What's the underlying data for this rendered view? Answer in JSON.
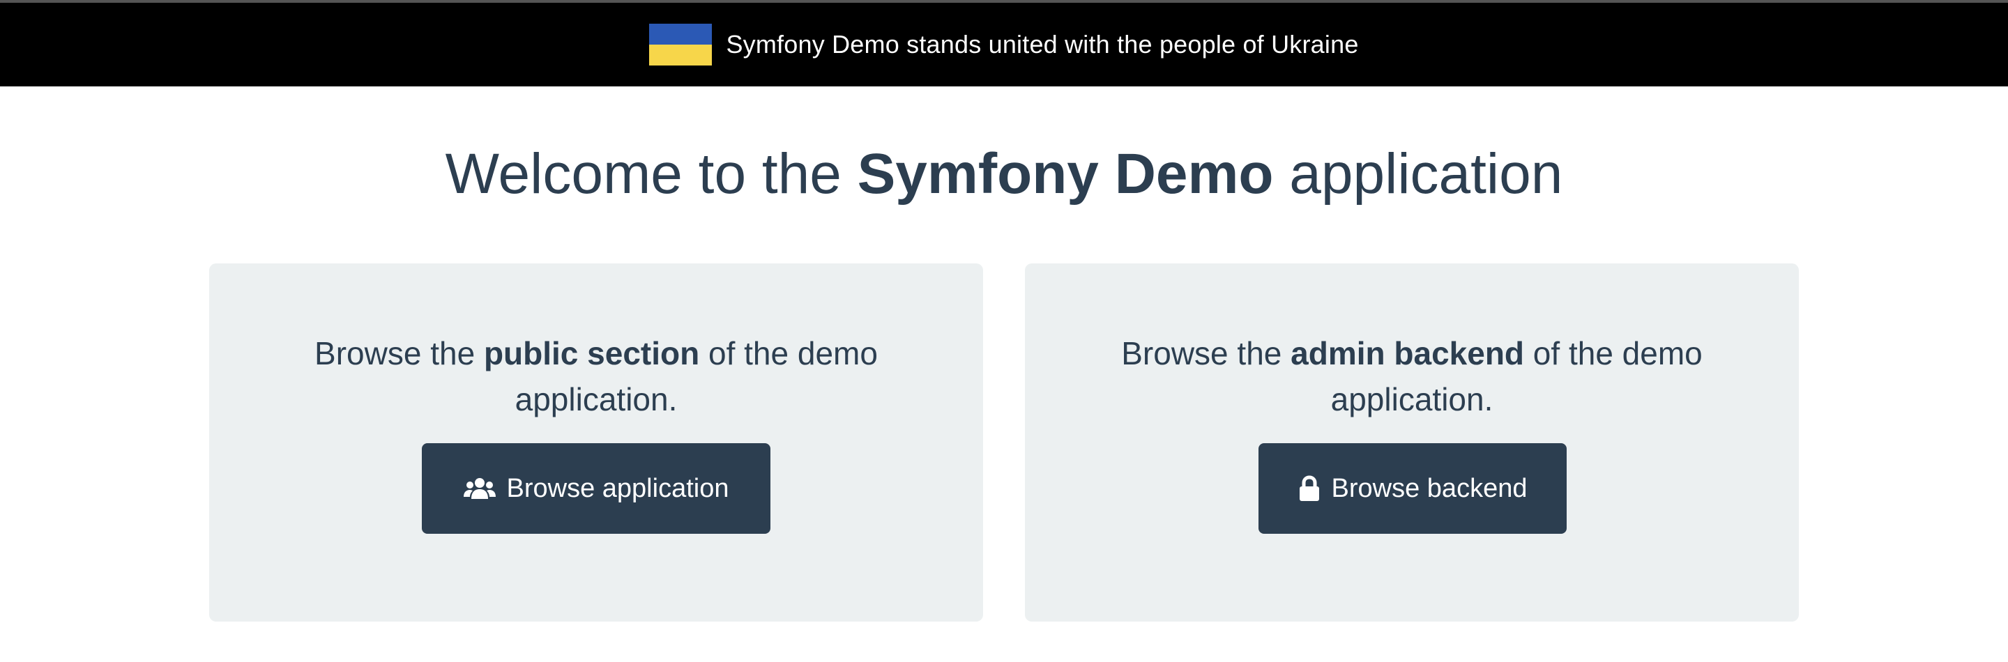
{
  "banner": {
    "text": "Symfony Demo stands united with the people of Ukraine",
    "flag_colors": [
      "#2b59b5",
      "#f7d64a"
    ]
  },
  "title": {
    "prefix": "Welcome to the ",
    "bold": "Symfony Demo",
    "suffix": " application"
  },
  "panels": [
    {
      "text_prefix": "Browse the ",
      "text_bold": "public section",
      "text_suffix": " of the demo",
      "text_line2": "application.",
      "button_label": "Browse application",
      "button_icon": "users-icon"
    },
    {
      "text_prefix": "Browse the ",
      "text_bold": "admin backend",
      "text_suffix": " of the demo",
      "text_line2": "application.",
      "button_label": "Browse backend",
      "button_icon": "lock-icon"
    }
  ],
  "colors": {
    "primary": "#2c3e50",
    "panel_bg": "#ecf0f1",
    "banner_bg": "#000000"
  }
}
